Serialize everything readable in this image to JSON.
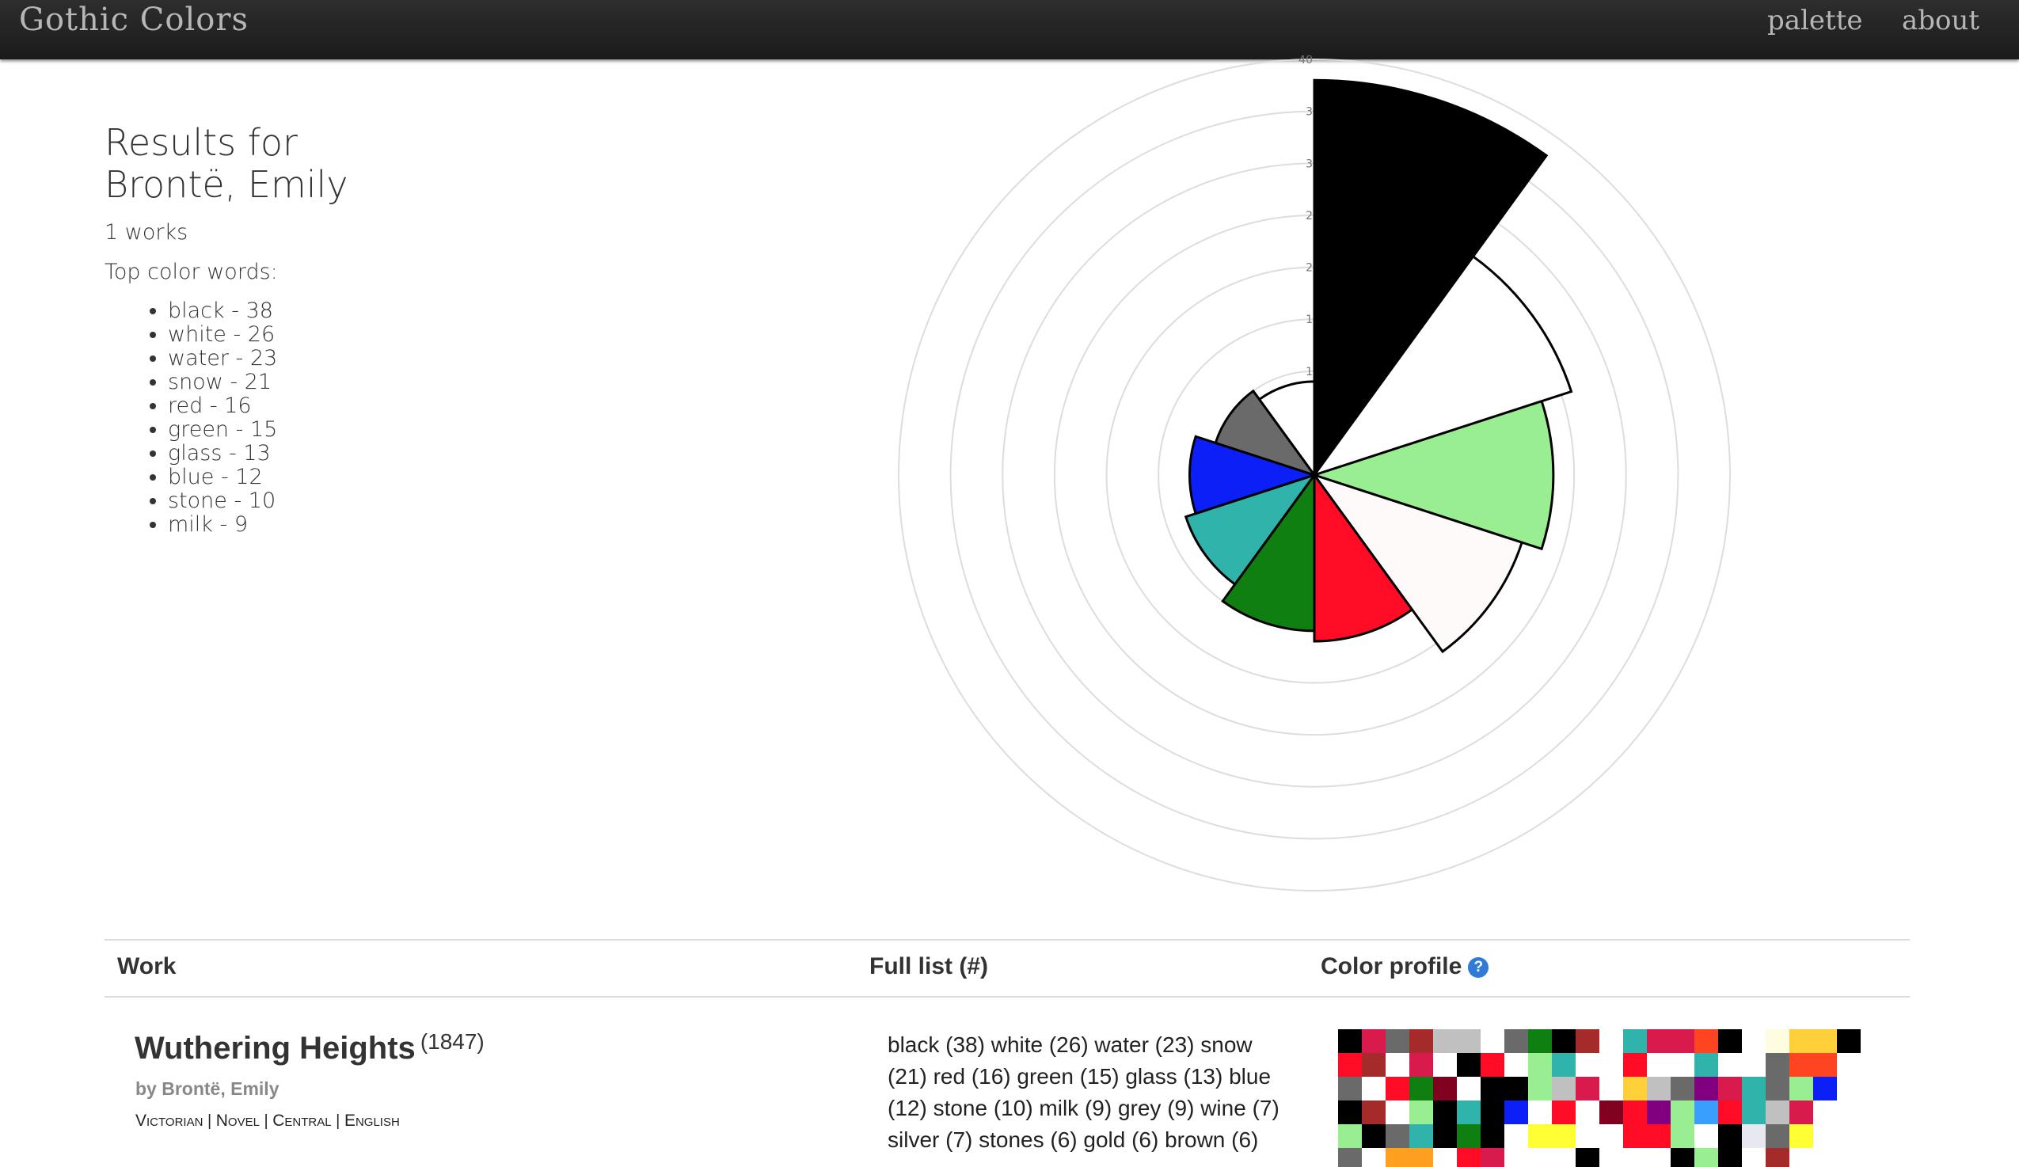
{
  "header": {
    "brand": "Gothic Colors",
    "nav": [
      {
        "label": "palette"
      },
      {
        "label": "about"
      }
    ]
  },
  "summary": {
    "title_line1": "Results for",
    "title_line2": "Brontë, Emily",
    "works_count": "1 works",
    "top_label": "Top color words:",
    "top_words": [
      "black - 38",
      "white - 26",
      "water - 23",
      "snow - 21",
      "red - 16",
      "green - 15",
      "glass - 13",
      "blue - 12",
      "stone - 10",
      "milk - 9"
    ]
  },
  "chart_data": {
    "type": "polar-area",
    "rmax": 40,
    "rings": [
      5,
      10,
      15,
      20,
      25,
      30,
      35,
      40
    ],
    "ring_labels": [
      "1",
      "1",
      "2",
      "2",
      "3",
      "3",
      "40"
    ],
    "slices": [
      {
        "word": "black",
        "value": 38,
        "color": "#000000"
      },
      {
        "word": "white",
        "value": 26,
        "color": "#ffffff"
      },
      {
        "word": "water",
        "value": 23,
        "color": "#98ee90"
      },
      {
        "word": "snow",
        "value": 21,
        "color": "#fffafa"
      },
      {
        "word": "red",
        "value": 16,
        "color": "#ff0b25"
      },
      {
        "word": "green",
        "value": 15,
        "color": "#0f7f12"
      },
      {
        "word": "glass",
        "value": 13,
        "color": "#2fb3aa"
      },
      {
        "word": "blue",
        "value": 12,
        "color": "#0c1ff6"
      },
      {
        "word": "stone",
        "value": 10,
        "color": "#6a6a6a"
      },
      {
        "word": "milk",
        "value": 9,
        "color": "#ffffff"
      }
    ]
  },
  "table": {
    "headers": {
      "work": "Work",
      "list": "Full list (#)",
      "profile": "Color profile"
    },
    "help_icon": "question-icon",
    "row": {
      "title": "Wuthering Heights",
      "year": "(1847)",
      "author": "by Brontë, Emily",
      "tags": [
        "Victorian",
        "Novel",
        "Central",
        "English"
      ],
      "tag_sep": "|",
      "full_list": "black (38) white (26) water (23) snow (21) red (16) green (15) glass (13) blue (12) stone (10) milk (9) grey (9) wine (7) silver (7) stones (6) gold (6) brown (6)"
    },
    "profile_colors": [
      "#000000",
      "#d81b4c",
      "#6a6a6a",
      "#a52a2a",
      "#c0c0c0",
      "#c0c0c0",
      "#ffffff",
      "#6a6a6a",
      "#0f7f12",
      "#000000",
      "#a52a2a",
      "#ffffff",
      "#2fb3aa",
      "#d81b4c",
      "#d81b4c",
      "#ff4422",
      "#000000",
      "#ffffff",
      "#fffde0",
      "#ffcf3a",
      "#ffcf3a",
      "#000000",
      "#ff0b25",
      "#a52a2a",
      "#ffffff",
      "#d81b4c",
      "#ffffff",
      "#000000",
      "#ff0b25",
      "#ffffff",
      "#98ee90",
      "#2fb3aa",
      "#ffffff",
      "#ffffff",
      "#ff0b25",
      "#ffffff",
      "#ffffff",
      "#2fb3aa",
      "#ffffff",
      "#ffffff",
      "#6a6a6a",
      "#ff4422",
      "#ff4422",
      "#ffffff",
      "#6a6a6a",
      "#ffffff",
      "#ff0b25",
      "#0f7f12",
      "#800020",
      "#ffffff",
      "#000000",
      "#000000",
      "#98ee90",
      "#c0c0c0",
      "#d81b4c",
      "#ffffff",
      "#ffcf3a",
      "#c0c0c0",
      "#6a6a6a",
      "#800080",
      "#d81b4c",
      "#2fb3aa",
      "#6a6a6a",
      "#98ee90",
      "#0c1ff6",
      "#ffffff",
      "#000000",
      "#a52a2a",
      "#ffffff",
      "#98ee90",
      "#000000",
      "#2fb3aa",
      "#000000",
      "#0c1ff6",
      "#ffffff",
      "#ff0b25",
      "#ffffff",
      "#800020",
      "#ff0b25",
      "#800080",
      "#98ee90",
      "#3a9eff",
      "#ff0b25",
      "#2fb3aa",
      "#c0c0c0",
      "#d81b4c",
      "#ffffff",
      "#ffffff",
      "#98ee90",
      "#000000",
      "#6a6a6a",
      "#2fb3aa",
      "#000000",
      "#0f7f12",
      "#000000",
      "#ffffff",
      "#ffff33",
      "#ffff33",
      "#ffffff",
      "#ffffff",
      "#ff0b25",
      "#ff0b25",
      "#98ee90",
      "#ffffff",
      "#000000",
      "#e8e8f0",
      "#6a6a6a",
      "#ffff33",
      "#ffffff",
      "#ffffff",
      "#6a6a6a",
      "#ffffff",
      "#ffa020",
      "#ffa020",
      "#ffffff",
      "#ff0b25",
      "#d81b4c",
      "#ffffff",
      "#ffffff",
      "#ffffff",
      "#000000",
      "#ffffff",
      "#ffffff",
      "#ffffff",
      "#000000",
      "#98ee90",
      "#000000",
      "#ffffff",
      "#a52a2a",
      "#ffffff",
      "#ffffff",
      "#ffffff"
    ]
  }
}
